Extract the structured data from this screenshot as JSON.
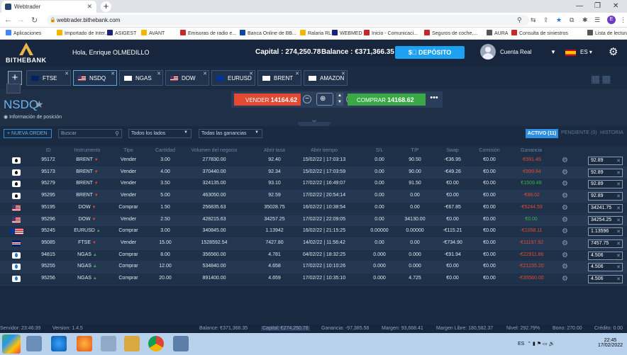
{
  "browser": {
    "tab_title": "Webtrader",
    "url": "webtrader.bithebank.com",
    "bookmarks": [
      {
        "label": "Aplicaciones",
        "color": "#4285f4"
      },
      {
        "label": "Importado de Inter...",
        "color": "#f4b400"
      },
      {
        "label": "ASIGEST",
        "color": "#1a237e"
      },
      {
        "label": "AVANT",
        "color": "#f4b400"
      },
      {
        "label": "Emisoras de radio e...",
        "color": "#c62828"
      },
      {
        "label": "Banca Online de BB...",
        "color": "#0d47a1"
      },
      {
        "label": "Ralaria RLS",
        "color": "#f4b400"
      },
      {
        "label": "WEBMED",
        "color": "#1a237e"
      },
      {
        "label": "Inicio - Comunicaci...",
        "color": "#c62828"
      },
      {
        "label": "Seguros de coche,...",
        "color": "#c62828"
      },
      {
        "label": "AURA",
        "color": "#555555"
      },
      {
        "label": "Consulta de siniestros",
        "color": "#c62828"
      },
      {
        "label": "Lista de lectura",
        "color": "#555555"
      }
    ],
    "profile_initial": "E"
  },
  "header": {
    "logo_text": "BITHEBANK",
    "greeting": "Hola, Enrique OLMEDILLO",
    "capital": "Capital : 274,250.78",
    "balance": "Balance : €371,366.35",
    "deposit_label": "DEPÓSITO",
    "account_label": "Cuenta Real",
    "language": "ES"
  },
  "instrument_tabs": [
    {
      "label": "FTSE",
      "flag": "uk"
    },
    {
      "label": "NSDQ",
      "flag": "us",
      "active": true
    },
    {
      "label": "NGAS",
      "flag": "blk"
    },
    {
      "label": "DOW",
      "flag": "us"
    },
    {
      "label": "EURUSD",
      "flag": "eu"
    },
    {
      "label": "BRENT",
      "flag": "blk"
    },
    {
      "label": "AMAZON",
      "flag": "blk"
    }
  ],
  "symbol": {
    "name": "NSDQ",
    "info_link": "Información de posición",
    "sell_label": "VENDER",
    "sell_price": "14164.62",
    "buy_label": "COMPRAR",
    "buy_price": "14168.62",
    "quantity": "1"
  },
  "orders": {
    "new_order": "+ NUEVA ORDEN",
    "search_placeholder": "Buscar",
    "filter_side": "Todos los lados",
    "filter_profit": "Todas las ganancias",
    "tab_active": "ACTIVO (11)",
    "tab_pending": "PENDIENTE (0)",
    "tab_history": "HISTORIA",
    "columns": [
      "ID",
      "Instrumento",
      "Tipo",
      "Cantidad",
      "Volumen del negocio",
      "Abrir tasa",
      "Abrir tiempo",
      "S/L",
      "T/P",
      "Swap",
      "Comisión",
      "Ganancia"
    ],
    "rows": [
      {
        "icon": "oil",
        "id": "95172",
        "inst": "BRENT",
        "dir": "down",
        "type": "Vender",
        "qty": "3.00",
        "vol": "277830.00",
        "rate": "92.40",
        "time": "15/02/22 | 17:03:13",
        "sl": "0.00",
        "tp": "90.50",
        "swap": "-€36.95",
        "com": "€0.00",
        "profit": "-€591.45",
        "ps": "neg",
        "box": "92.89"
      },
      {
        "icon": "oil",
        "id": "95173",
        "inst": "BRENT",
        "dir": "down",
        "type": "Vender",
        "qty": "4.00",
        "vol": "370440.00",
        "rate": "92.34",
        "time": "15/02/22 | 17:03:59",
        "sl": "0.00",
        "tp": "90.00",
        "swap": "-€49.26",
        "com": "€0.00",
        "profit": "-€999.84",
        "ps": "neg",
        "box": "92.89"
      },
      {
        "icon": "oil",
        "id": "95279",
        "inst": "BRENT",
        "dir": "down",
        "type": "Vender",
        "qty": "3.50",
        "vol": "324135.00",
        "rate": "93.10",
        "time": "17/02/22 | 16:49:07",
        "sl": "0.00",
        "tp": "91.50",
        "swap": "€0.00",
        "com": "€0.00",
        "profit": "€1509.48",
        "ps": "pos",
        "box": "92.89"
      },
      {
        "icon": "oil",
        "id": "95295",
        "inst": "BRENT",
        "dir": "down",
        "type": "Vender",
        "qty": "5.00",
        "vol": "463050.00",
        "rate": "92.59",
        "time": "17/02/22 | 20:54:14",
        "sl": "0.00",
        "tp": "0.00",
        "swap": "€0.00",
        "com": "€0.00",
        "profit": "-€88.02",
        "ps": "neg",
        "box": "92.89"
      },
      {
        "icon": "us",
        "id": "95195",
        "inst": "DOW",
        "dir": "down",
        "type": "Comprar",
        "qty": "1.50",
        "vol": "256835.63",
        "rate": "35028.75",
        "time": "16/02/22 | 10:38:54",
        "sl": "0.00",
        "tp": "0.00",
        "swap": "-€67.85",
        "com": "€0.00",
        "profit": "-€5244.59",
        "ps": "neg",
        "box": "34241.75"
      },
      {
        "icon": "us",
        "id": "95296",
        "inst": "DOW",
        "dir": "down",
        "type": "Vender",
        "qty": "2.50",
        "vol": "428215.63",
        "rate": "34257.25",
        "time": "17/02/22 | 22:09:05",
        "sl": "0.00",
        "tp": "34130.00",
        "swap": "€0.00",
        "com": "€0.00",
        "profit": "€0.00",
        "ps": "pos",
        "box": "34254.25"
      },
      {
        "icon": "eu",
        "id": "95245",
        "inst": "EURUSD",
        "dir": "up",
        "type": "Comprar",
        "qty": "3.00",
        "vol": "340845.00",
        "rate": "1.13942",
        "time": "16/02/22 | 21:15:25",
        "sl": "0.00000",
        "tp": "0.00000",
        "swap": "-€115.21",
        "com": "€0.00",
        "profit": "-€1058.11",
        "ps": "neg",
        "box": "1.13596"
      },
      {
        "icon": "uk",
        "id": "95085",
        "inst": "FTSE",
        "dir": "down",
        "type": "Vender",
        "qty": "15.00",
        "vol": "1528592.54",
        "rate": "7427.80",
        "time": "14/02/22 | 11:56:42",
        "sl": "0.00",
        "tp": "0.00",
        "swap": "-€734.90",
        "com": "€0.00",
        "profit": "-€11197.92",
        "ps": "neg",
        "box": "7457.75"
      },
      {
        "icon": "gas",
        "id": "94815",
        "inst": "NGAS",
        "dir": "up",
        "type": "Comprar",
        "qty": "8.00",
        "vol": "356560.00",
        "rate": "4.781",
        "time": "04/02/22 | 18:32:25",
        "sl": "0.000",
        "tp": "0.000",
        "swap": "-€91.94",
        "com": "€0.00",
        "profit": "-€22911.86",
        "ps": "neg",
        "box": "4.506"
      },
      {
        "icon": "gas",
        "id": "95255",
        "inst": "NGAS",
        "dir": "up",
        "type": "Comprar",
        "qty": "12.00",
        "vol": "534840.00",
        "rate": "4.658",
        "time": "17/02/22 | 10:10:26",
        "sl": "0.000",
        "tp": "0.000",
        "swap": "€0.00",
        "com": "€0.00",
        "profit": "-€21235.20",
        "ps": "neg",
        "box": "4.506"
      },
      {
        "icon": "gas",
        "id": "95256",
        "inst": "NGAS",
        "dir": "up",
        "type": "Comprar",
        "qty": "20.00",
        "vol": "891400.00",
        "rate": "4.659",
        "time": "17/02/22 | 10:35:10",
        "sl": "0.000",
        "tp": "4.725",
        "swap": "€0.00",
        "com": "€0.00",
        "profit": "-€35560.00",
        "ps": "neg",
        "box": "4.506"
      }
    ]
  },
  "status": {
    "server": "Servidor: 23:46:39",
    "version": "Version: 1.4.5",
    "balance": "Balance: €371,366.35",
    "capital": "Capital: €274,250.78",
    "ganancia": "Ganancia: -97,385.58",
    "margen": "Margen: 93,668.41",
    "margen_libre": "Margen Libre: 180,582.37",
    "nivel": "Nivel: 292.79%",
    "bono": "Bono: 270.00",
    "credito": "Crédito: 0.00"
  },
  "taskbar": {
    "tray": "ES",
    "time": "22:45",
    "date": "17/02/2022"
  }
}
